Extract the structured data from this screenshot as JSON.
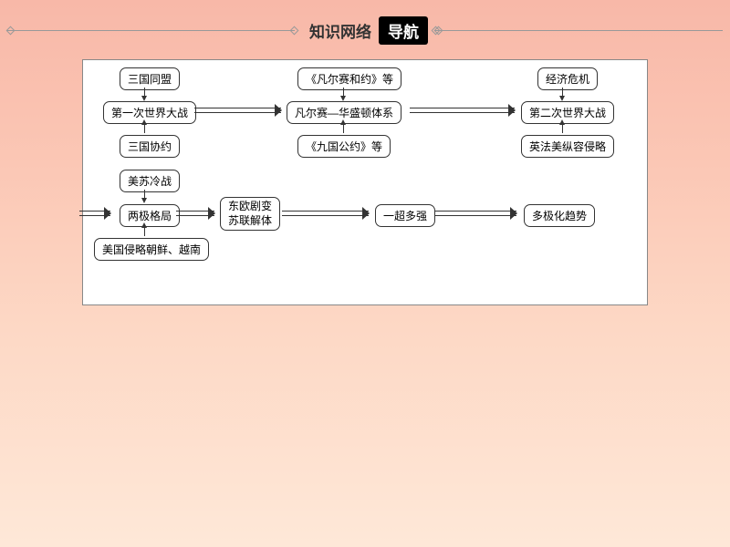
{
  "header": {
    "light": "知识网络",
    "dark": "导航"
  },
  "nodes": {
    "r1a": "三国同盟",
    "r1b": "《凡尔赛和约》等",
    "r1c": "经济危机",
    "r2a": "第一次世界大战",
    "r2b": "凡尔赛—华盛顿体系",
    "r2c": "第二次世界大战",
    "r3a": "三国协约",
    "r3b": "《九国公约》等",
    "r3c": "英法美纵容侵略",
    "r4a": "美苏冷战",
    "r5a": "两极格局",
    "r5b_l1": "东欧剧变",
    "r5b_l2": "苏联解体",
    "r5c": "一超多强",
    "r5d": "多极化趋势",
    "r6a": "美国侵略朝鲜、越南"
  }
}
